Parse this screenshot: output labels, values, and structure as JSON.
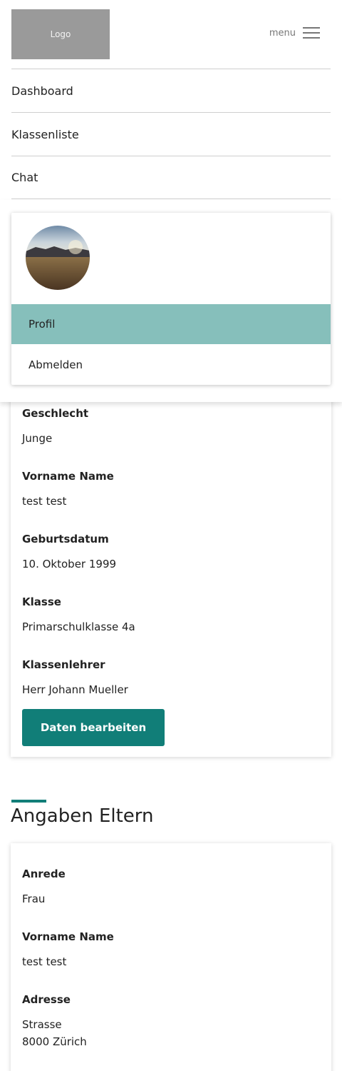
{
  "header": {
    "logo_text": "Logo",
    "menu_label": "menu"
  },
  "nav": {
    "items": [
      "Dashboard",
      "Klassenliste",
      "Chat"
    ]
  },
  "user_menu": {
    "items": [
      "Profil",
      "Abmelden"
    ],
    "active_item": "Profil",
    "active_color": "#86bfbb"
  },
  "student": {
    "fields": [
      {
        "label": "Geschlecht",
        "value": "Junge"
      },
      {
        "label": "Vorname Name",
        "value": "test test"
      },
      {
        "label": "Geburtsdatum",
        "value": "10. Oktober 1999"
      },
      {
        "label": "Klasse",
        "value": "Primarschulklasse 4a"
      },
      {
        "label": "Klassenlehrer",
        "value": "Herr Johann Mueller"
      }
    ],
    "edit_button_label": "Daten bearbeiten"
  },
  "parents": {
    "title": "Angaben Eltern",
    "fields": [
      {
        "label": "Anrede",
        "value": "Frau"
      },
      {
        "label": "Vorname Name",
        "value": "test test"
      },
      {
        "label": "Adresse",
        "value_lines": [
          "Strasse",
          "8000 Zürich"
        ]
      }
    ]
  },
  "theme": {
    "accent": "#117e78"
  }
}
